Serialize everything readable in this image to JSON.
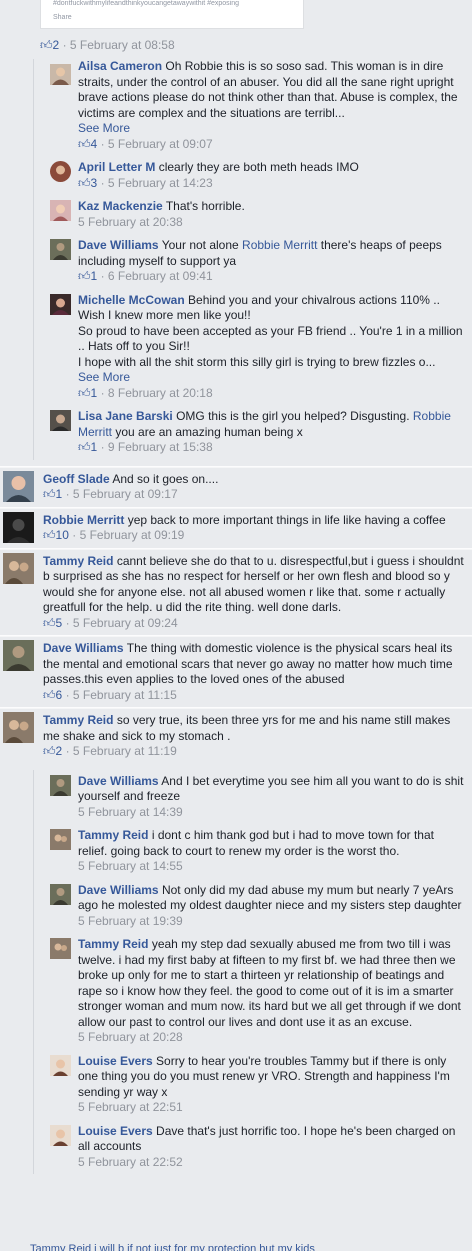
{
  "top_card": {
    "hashtags": "#dontfuckwithmylifeandthinkyoucangetawaywithit #exposing",
    "share_label": "Share"
  },
  "root_meta": {
    "likes": "2",
    "time": "5 February at 08:58"
  },
  "like_icon": "thumbs-up-icon",
  "replies_root": [
    {
      "author": "Ailsa Cameron",
      "text": "Oh Robbie this is so soso sad. This woman is in dire straits, under the control of an abuser. You did all the sane right upright brave actions please do not think other than that. Abuse is complex, the victims are complex and the situations are terribl...",
      "see_more": "See More",
      "likes": "4",
      "time": "5 February at 09:07"
    },
    {
      "author": "April Letter M",
      "text": "clearly they are both meth heads IMO",
      "likes": "3",
      "time": "5 February at 14:23"
    },
    {
      "author": "Kaz Mackenzie",
      "text": "That's horrible.",
      "time": "5 February at 20:38"
    },
    {
      "author": "Dave Williams",
      "text_before": "Your not alone",
      "mention": "Robbie Merritt",
      "text_after": "there's heaps of peeps including myself to support ya",
      "likes": "1",
      "time": "6 February at 09:41"
    },
    {
      "author": "Michelle McCowan",
      "text": "Behind you and your chivalrous actions 110% .. Wish I knew more men like you!!",
      "text2": "So proud to have been accepted as your FB friend .. You're 1 in a million .. Hats off to you Sir!!",
      "text3": "I hope with all the shit storm this silly girl is trying to brew fizzles o...",
      "see_more": "See More",
      "likes": "1",
      "time": "8 February at 20:18"
    },
    {
      "author": "Lisa Jane Barski",
      "text": "OMG this is the girl you helped? Disgusting.",
      "mention": "Robbie Merritt",
      "text_after": "you are an amazing human being x",
      "likes": "1",
      "time": "9 February at 15:38"
    }
  ],
  "top_comments": [
    {
      "author": "Geoff Slade",
      "text": "And so it goes on....",
      "likes": "1",
      "time": "5 February at 09:17"
    },
    {
      "author": "Robbie Merritt",
      "text": "yep back to more important things in life like having a coffee",
      "likes": "10",
      "time": "5 February at 09:19"
    },
    {
      "author": "Tammy Reid",
      "text": "cannt believe she do that to u. disrespectful,but i guess i shouldnt b surprised as she has no respect for herself or her own flesh and blood so y would she for anyone else. not all abused women r like that. some r actually greatfull for the help. u did the rite thing. well done darls.",
      "likes": "5",
      "time": "5 February at 09:24"
    },
    {
      "author": "Dave Williams",
      "text": "The thing with domestic violence is the physical scars heal its the mental and emotional scars that never go away no matter how much time passes.this even applies to the loved ones of the abused",
      "likes": "6",
      "time": "5 February at 11:15"
    },
    {
      "author": "Tammy Reid",
      "text": "so very true, its been three yrs for me and his name still makes me shake and sick to my stomach .",
      "likes": "2",
      "time": "5 February at 11:19"
    }
  ],
  "replies_tammy": [
    {
      "author": "Dave Williams",
      "text": "And I bet everytime you see him all you want to do is shit yourself and freeze",
      "time": "5 February at 14:39"
    },
    {
      "author": "Tammy Reid",
      "text": "i dont c him thank god but i had to move town for that relief. going back to court to renew my order is the worst tho.",
      "time": "5 February at 14:55"
    },
    {
      "author": "Dave Williams",
      "text": "Not only did my dad abuse my mum but nearly 7 yeArs ago he molested my oldest daughter niece and my sisters step daughter",
      "time": "5 February at 19:39"
    },
    {
      "author": "Tammy Reid",
      "text": "yeah my step dad sexually abused me from two till i was twelve. i had my first baby at fifteen to my first bf. we had three then we broke up only for me to start a thirteen yr relationship of beatings and rape so i know how they feel. the good to come out of it is im a smarter stronger woman and mum now. its hard but we all get through if we dont allow our past to control our lives and dont use it as an excuse.",
      "time": "5 February at 20:28"
    },
    {
      "author": "Louise Evers",
      "text": "Sorry to hear you're troubles Tammy but if there is only one thing you do you must renew yr VRO. Strength and happiness I'm sending yr way x",
      "time": "5 February at 22:51"
    },
    {
      "author": "Louise Evers",
      "text": "Dave that's just horrific too. I hope he's been charged on all accounts",
      "time": "5 February at 22:52"
    }
  ],
  "cut_off_line": "Tammy Reid i will b if not just for my protection but my kids",
  "colors": {
    "link": "#365899",
    "meta": "#90949c",
    "bg": "#e9ebee"
  }
}
